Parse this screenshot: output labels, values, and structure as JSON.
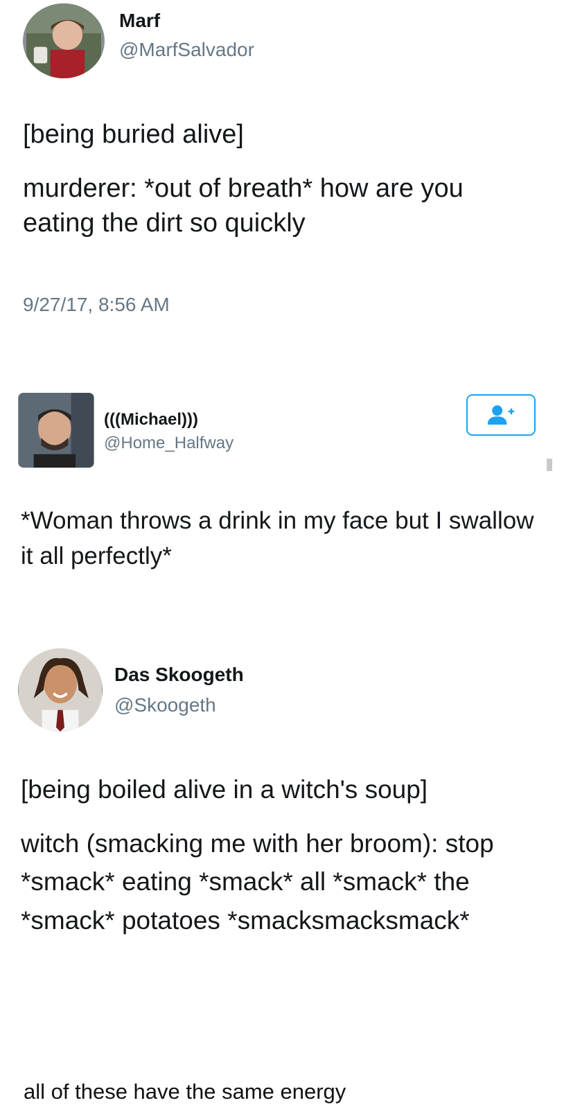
{
  "tweets": [
    {
      "name": "Marf",
      "handle": "@MarfSalvador",
      "lines": [
        "[being buried alive]",
        "murderer: *out of breath* how are you eating the dirt so quickly"
      ],
      "timestamp": "9/27/17, 8:56 AM"
    },
    {
      "name": "(((Michael)))",
      "handle": "@Home_Halfway",
      "lines": [
        "*Woman throws a drink in my face but I swallow it all perfectly*"
      ]
    },
    {
      "name": "Das Skoogeth",
      "handle": "@Skoogeth",
      "lines": [
        "[being boiled alive in a witch's soup]",
        "witch (smacking me with her broom): stop *smack* eating *smack* all *smack* the *smack* potatoes *smacksmacksmack*"
      ]
    }
  ],
  "caption": "all of these have the same energy",
  "icons": {
    "follow": "follow-user-icon"
  },
  "colors": {
    "accent": "#1da1f2",
    "handle": "#657786",
    "text": "#14171a"
  }
}
